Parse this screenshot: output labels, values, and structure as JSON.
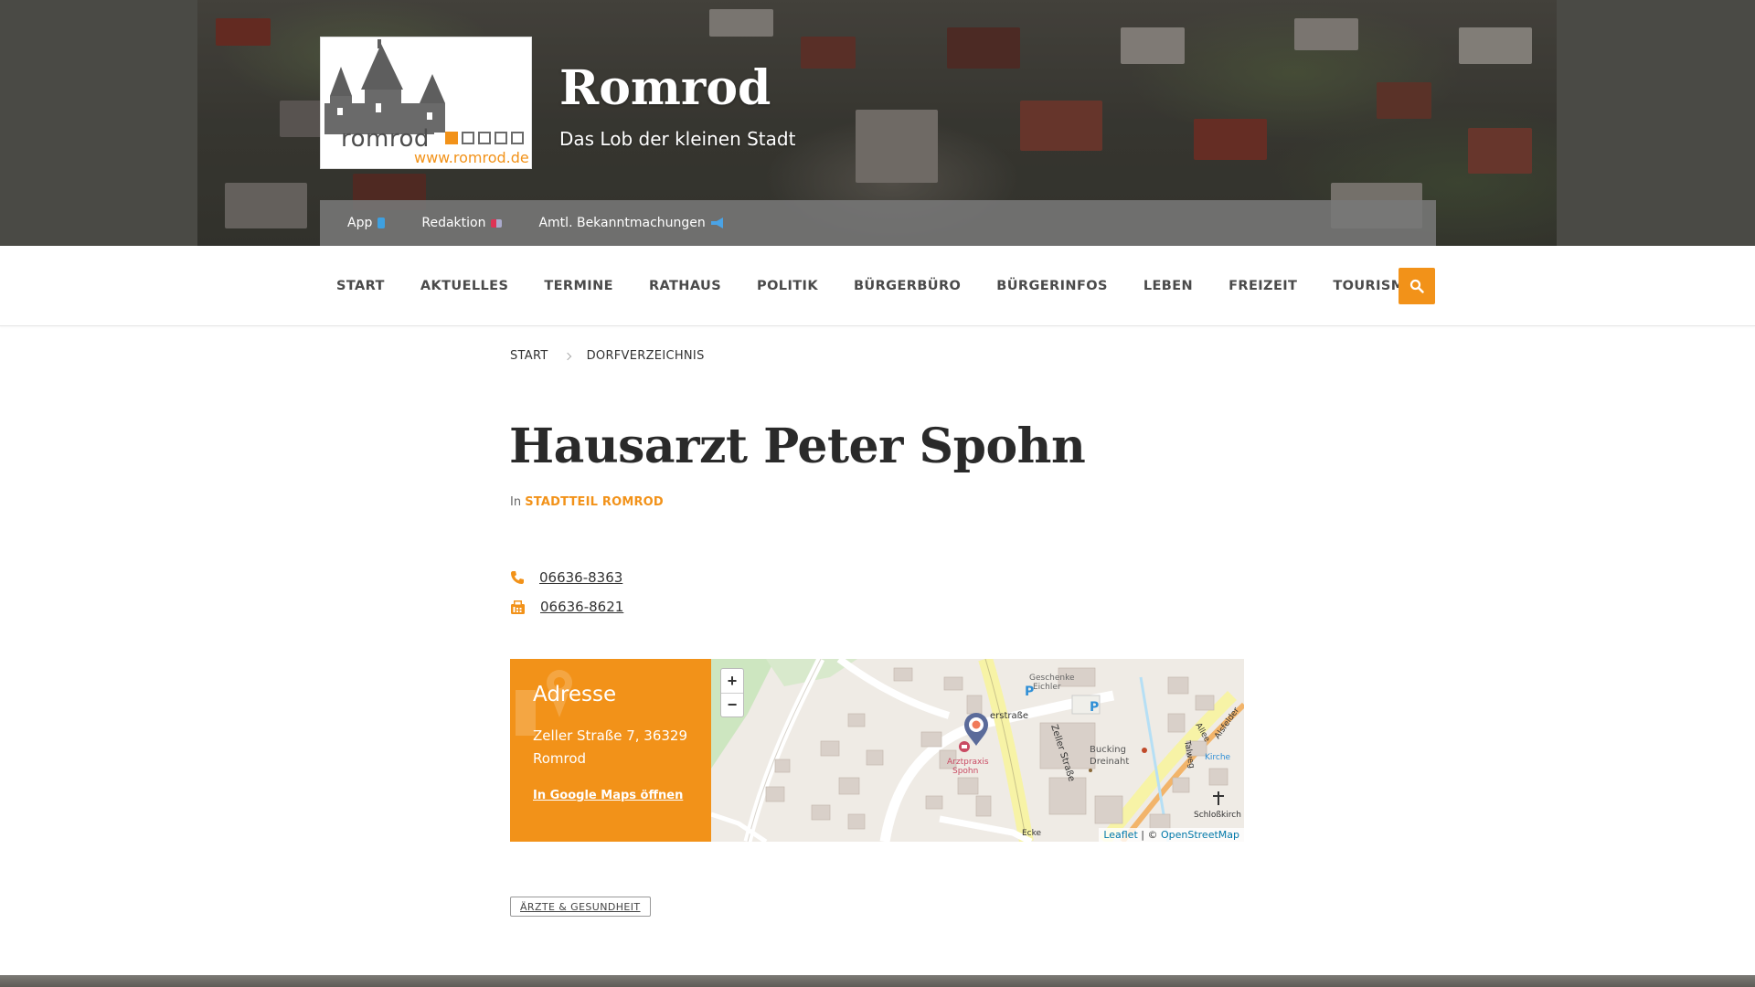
{
  "colors": {
    "accent": "#f29219",
    "text": "#333333",
    "topbar": "#787878"
  },
  "header": {
    "logo": {
      "word": "romrod",
      "url": "www.romrod.de"
    },
    "title": "Romrod",
    "tagline": "Das Lob der kleinen Stadt"
  },
  "topbar": {
    "items": [
      {
        "label": "App",
        "icon": "phone-icon"
      },
      {
        "label": "Redaktion",
        "icon": "flag-icon"
      },
      {
        "label": "Amtl. Bekanntmachungen",
        "icon": "megaphone-icon"
      }
    ]
  },
  "nav": {
    "items": [
      "START",
      "AKTUELLES",
      "TERMINE",
      "RATHAUS",
      "POLITIK",
      "BÜRGERBÜRO",
      "BÜRGERINFOS",
      "LEBEN",
      "FREIZEIT",
      "TOURISMUS"
    ],
    "search_icon": "search-icon"
  },
  "breadcrumb": [
    "START",
    "DORFVERZEICHNIS"
  ],
  "page": {
    "title": "Hausarzt Peter Spohn",
    "category_prefix": "In",
    "category": "STADTTEIL ROMROD",
    "phone": "06636-8363",
    "fax": "06636-8621"
  },
  "address": {
    "title": "Adresse",
    "text": "Zeller Straße 7, 36329 Romrod",
    "maps_link": "In Google Maps öffnen"
  },
  "map": {
    "zoom_in": "+",
    "zoom_out": "−",
    "labels": {
      "street1": "erstraße",
      "street2": "Zeller Straße",
      "street3": "Talweg",
      "street4": "Alsfelder",
      "street5": "Allee",
      "marker_label_1": "Arztpraxis",
      "marker_label_2": "Spohn",
      "shop1": "Geschenke",
      "shop2": "Eichler",
      "shop3": "Bucking",
      "shop4": "Dreinaht",
      "church": "Kirche",
      "castle": "Schloßkirch",
      "corner": "Ecke",
      "parking": "P"
    },
    "attribution_leaflet": "Leaflet",
    "attribution_sep": " | © ",
    "attribution_osm": "OpenStreetMap"
  },
  "tag": "ÄRZTE & GESUNDHEIT"
}
